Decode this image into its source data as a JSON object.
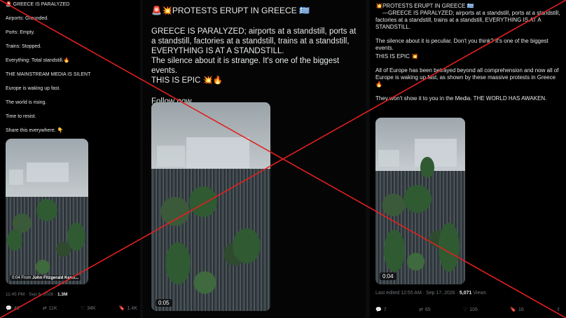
{
  "panel1": {
    "lines": [
      "🚨 GREECE IS PARALYZED",
      "Airports: Grounded.",
      "Ports: Empty.",
      "Trains: Stopped.",
      "Everything: Total standstill.🔥",
      "THE MAINSTREAM MEDIA IS SILENT",
      "Europe is waking up fast.",
      "The world is rising.",
      "Time to resist.",
      "Share this everywhere. 👇"
    ],
    "video_duration": "0:04",
    "video_from": "From",
    "video_source": "John Fitzgerald Kenn...",
    "timestamp": "11:45 PM · Sep 6, 2026 ·",
    "views": "1.3M",
    "actions": {
      "replies": "48",
      "reposts": "11K",
      "likes": "34K",
      "bookmarks": "1.4K"
    }
  },
  "panel2": {
    "title": "🚨💥PROTESTS ERUPT IN GREECE 🇬🇷",
    "body": "GREECE IS PARALYZED; airports at a standstill, ports at a standstill, factories at a standstill, trains at a standstill, EVERYTHING IS AT A STANDSTILL.",
    "line2": "The silence about it is strange. It's one of the biggest events.",
    "line3": "THIS IS EPIC 💥🔥",
    "follow": "Follow now.",
    "video_duration": "0:05"
  },
  "panel3": {
    "title": "💥PROTESTS ERUPT IN GREECE 🇬🇷",
    "body": "—GREECE IS PARALYZED; airports at a standstill, ports at a standstill, factories at a standstill, trains at a standstill, EVERYTHING IS AT A STANDSTILL.",
    "para2": "The silence about it is peculiar. Don't you think? It's one of the biggest events.",
    "para3": "THIS IS EPIC 💥",
    "para4": "All of Europe has been betrayed beyond all comprehension and now all of Europe is waking up fast, as shown by these massive protests in Greece 🔥",
    "para5": "They won't show it to you in the Media. THE WORLD HAS AWAKEN.",
    "video_duration": "0:04",
    "meta": "Last edited 12:55 AM · Sep 17, 2026 ·",
    "views": "5,071",
    "views_label": "Views",
    "actions": {
      "replies": "7",
      "reposts": "65",
      "likes": "105",
      "bookmarks": "16"
    }
  },
  "overlay": {
    "cross_color": "#e0201f"
  }
}
